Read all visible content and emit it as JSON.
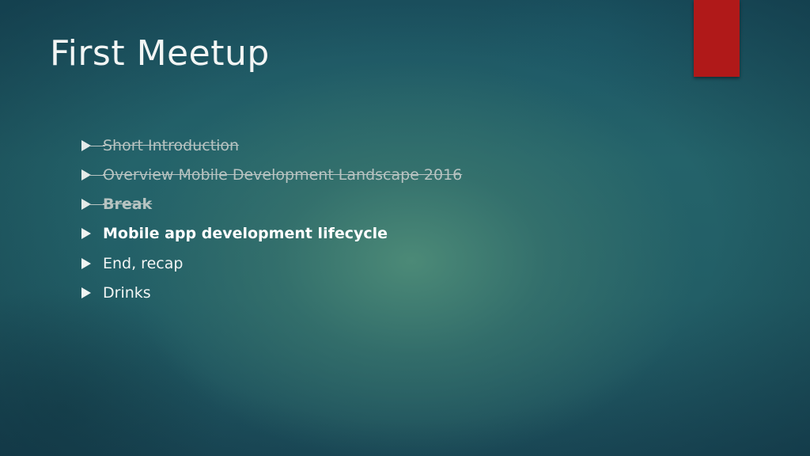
{
  "slide": {
    "title": "First Meetup",
    "accent_color": "#b01919",
    "agenda": [
      {
        "label": "Short Introduction",
        "state": "done"
      },
      {
        "label": "Overview Mobile Development Landscape 2016",
        "state": "done"
      },
      {
        "label": "Break",
        "state": "done"
      },
      {
        "label": "Mobile app development lifecycle",
        "state": "current"
      },
      {
        "label": "End, recap",
        "state": "todo"
      },
      {
        "label": "Drinks",
        "state": "todo"
      }
    ]
  }
}
